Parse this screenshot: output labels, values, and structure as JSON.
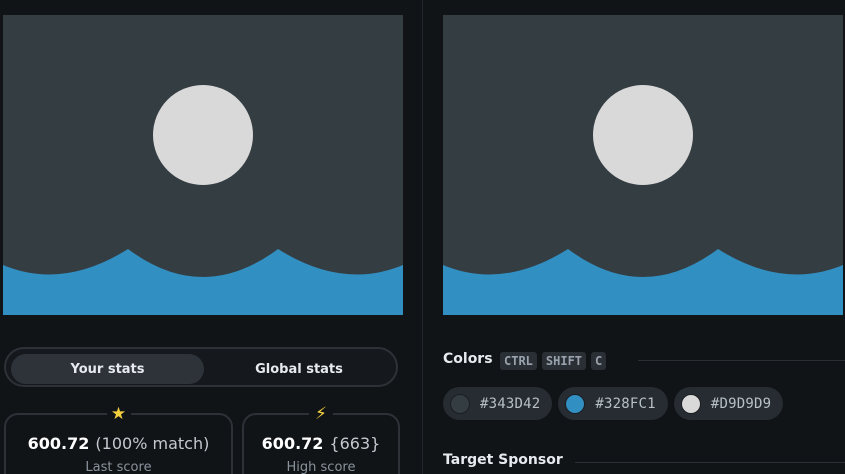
{
  "canvas": {
    "background": "#343D42",
    "wave": "#328FC1",
    "circle": "#D9D9D9"
  },
  "stats_tabs": {
    "your_stats": "Your stats",
    "global_stats": "Global stats",
    "active": "Your stats"
  },
  "cards": {
    "last": {
      "icon": "star-icon",
      "icon_glyph": "★",
      "score": "600.72",
      "extra": "(100% match)",
      "label": "Last score"
    },
    "high": {
      "icon": "lightning-icon",
      "icon_glyph": "⚡",
      "score": "600.72",
      "extra": "{663}",
      "label": "High score"
    }
  },
  "colors_section": {
    "title": "Colors",
    "shortcut": [
      "CTRL",
      "SHIFT",
      "C"
    ],
    "swatches": [
      {
        "hex": "#343D42",
        "color": "#343D42"
      },
      {
        "hex": "#328FC1",
        "color": "#328FC1"
      },
      {
        "hex": "#D9D9D9",
        "color": "#D9D9D9"
      }
    ]
  },
  "sponsor_section": {
    "title": "Target Sponsor"
  },
  "accent": {
    "icon_yellow": "#F4D03F"
  }
}
